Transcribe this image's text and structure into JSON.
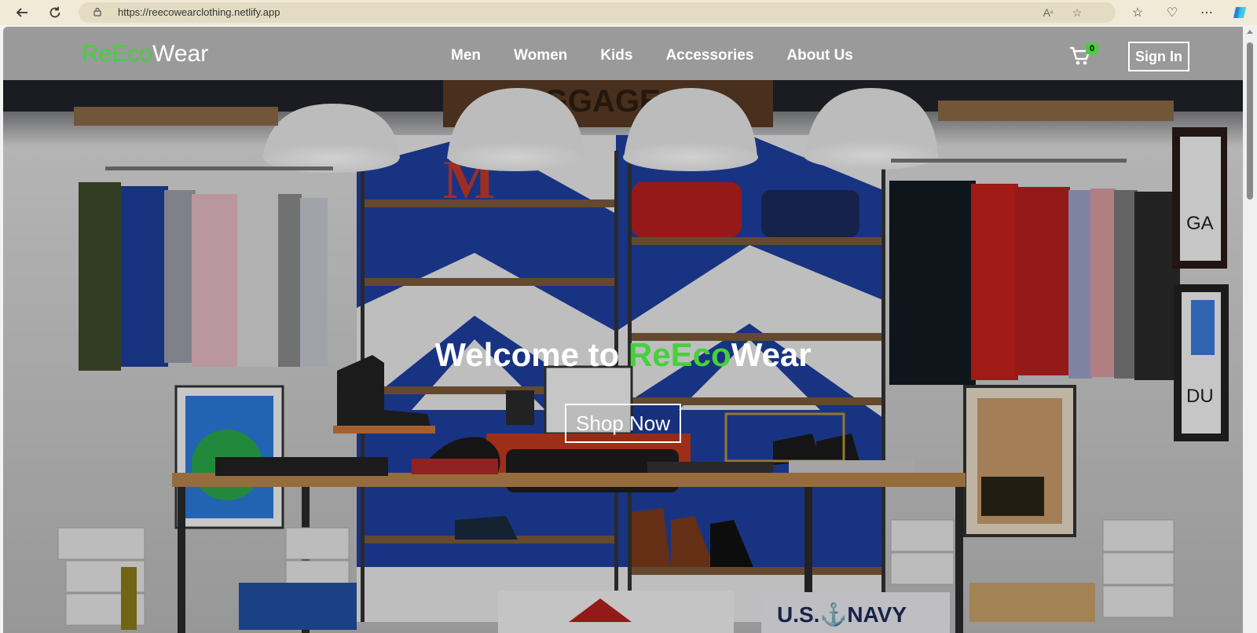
{
  "browser": {
    "url": "https://reecowearclothing.netlify.app",
    "icons": [
      "back-icon",
      "refresh-icon",
      "lock-icon",
      "read-aloud-icon",
      "favorite-star-icon",
      "favorites-icon",
      "browser-essentials-icon",
      "more-icon",
      "copilot-icon"
    ]
  },
  "header": {
    "logo_part1": "ReEco",
    "logo_part2": "Wear",
    "menu": [
      {
        "label": "Men"
      },
      {
        "label": "Women"
      },
      {
        "label": "Kids"
      },
      {
        "label": "Accessories"
      },
      {
        "label": "About Us"
      }
    ],
    "cart_count": "0",
    "signin_label": "Sign In"
  },
  "hero": {
    "title_prefix": "Welcome to ",
    "title_brand_green": "ReEco",
    "title_brand_white": "Wear",
    "cta_label": "Shop Now",
    "image": "clothing-store-interior"
  },
  "colors": {
    "brand_green": "#45d13b",
    "header_bg": "#9a9a9a",
    "chrome_bg": "#f0ead6"
  }
}
